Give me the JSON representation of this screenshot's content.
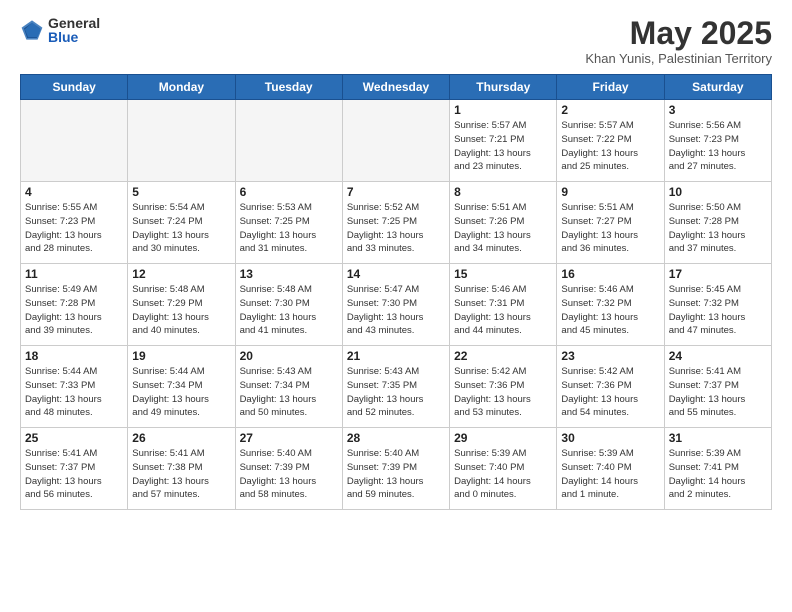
{
  "header": {
    "logo_general": "General",
    "logo_blue": "Blue",
    "month_title": "May 2025",
    "location": "Khan Yunis, Palestinian Territory"
  },
  "weekdays": [
    "Sunday",
    "Monday",
    "Tuesday",
    "Wednesday",
    "Thursday",
    "Friday",
    "Saturday"
  ],
  "weeks": [
    [
      {
        "day": "",
        "info": ""
      },
      {
        "day": "",
        "info": ""
      },
      {
        "day": "",
        "info": ""
      },
      {
        "day": "",
        "info": ""
      },
      {
        "day": "1",
        "info": "Sunrise: 5:57 AM\nSunset: 7:21 PM\nDaylight: 13 hours\nand 23 minutes."
      },
      {
        "day": "2",
        "info": "Sunrise: 5:57 AM\nSunset: 7:22 PM\nDaylight: 13 hours\nand 25 minutes."
      },
      {
        "day": "3",
        "info": "Sunrise: 5:56 AM\nSunset: 7:23 PM\nDaylight: 13 hours\nand 27 minutes."
      }
    ],
    [
      {
        "day": "4",
        "info": "Sunrise: 5:55 AM\nSunset: 7:23 PM\nDaylight: 13 hours\nand 28 minutes."
      },
      {
        "day": "5",
        "info": "Sunrise: 5:54 AM\nSunset: 7:24 PM\nDaylight: 13 hours\nand 30 minutes."
      },
      {
        "day": "6",
        "info": "Sunrise: 5:53 AM\nSunset: 7:25 PM\nDaylight: 13 hours\nand 31 minutes."
      },
      {
        "day": "7",
        "info": "Sunrise: 5:52 AM\nSunset: 7:25 PM\nDaylight: 13 hours\nand 33 minutes."
      },
      {
        "day": "8",
        "info": "Sunrise: 5:51 AM\nSunset: 7:26 PM\nDaylight: 13 hours\nand 34 minutes."
      },
      {
        "day": "9",
        "info": "Sunrise: 5:51 AM\nSunset: 7:27 PM\nDaylight: 13 hours\nand 36 minutes."
      },
      {
        "day": "10",
        "info": "Sunrise: 5:50 AM\nSunset: 7:28 PM\nDaylight: 13 hours\nand 37 minutes."
      }
    ],
    [
      {
        "day": "11",
        "info": "Sunrise: 5:49 AM\nSunset: 7:28 PM\nDaylight: 13 hours\nand 39 minutes."
      },
      {
        "day": "12",
        "info": "Sunrise: 5:48 AM\nSunset: 7:29 PM\nDaylight: 13 hours\nand 40 minutes."
      },
      {
        "day": "13",
        "info": "Sunrise: 5:48 AM\nSunset: 7:30 PM\nDaylight: 13 hours\nand 41 minutes."
      },
      {
        "day": "14",
        "info": "Sunrise: 5:47 AM\nSunset: 7:30 PM\nDaylight: 13 hours\nand 43 minutes."
      },
      {
        "day": "15",
        "info": "Sunrise: 5:46 AM\nSunset: 7:31 PM\nDaylight: 13 hours\nand 44 minutes."
      },
      {
        "day": "16",
        "info": "Sunrise: 5:46 AM\nSunset: 7:32 PM\nDaylight: 13 hours\nand 45 minutes."
      },
      {
        "day": "17",
        "info": "Sunrise: 5:45 AM\nSunset: 7:32 PM\nDaylight: 13 hours\nand 47 minutes."
      }
    ],
    [
      {
        "day": "18",
        "info": "Sunrise: 5:44 AM\nSunset: 7:33 PM\nDaylight: 13 hours\nand 48 minutes."
      },
      {
        "day": "19",
        "info": "Sunrise: 5:44 AM\nSunset: 7:34 PM\nDaylight: 13 hours\nand 49 minutes."
      },
      {
        "day": "20",
        "info": "Sunrise: 5:43 AM\nSunset: 7:34 PM\nDaylight: 13 hours\nand 50 minutes."
      },
      {
        "day": "21",
        "info": "Sunrise: 5:43 AM\nSunset: 7:35 PM\nDaylight: 13 hours\nand 52 minutes."
      },
      {
        "day": "22",
        "info": "Sunrise: 5:42 AM\nSunset: 7:36 PM\nDaylight: 13 hours\nand 53 minutes."
      },
      {
        "day": "23",
        "info": "Sunrise: 5:42 AM\nSunset: 7:36 PM\nDaylight: 13 hours\nand 54 minutes."
      },
      {
        "day": "24",
        "info": "Sunrise: 5:41 AM\nSunset: 7:37 PM\nDaylight: 13 hours\nand 55 minutes."
      }
    ],
    [
      {
        "day": "25",
        "info": "Sunrise: 5:41 AM\nSunset: 7:37 PM\nDaylight: 13 hours\nand 56 minutes."
      },
      {
        "day": "26",
        "info": "Sunrise: 5:41 AM\nSunset: 7:38 PM\nDaylight: 13 hours\nand 57 minutes."
      },
      {
        "day": "27",
        "info": "Sunrise: 5:40 AM\nSunset: 7:39 PM\nDaylight: 13 hours\nand 58 minutes."
      },
      {
        "day": "28",
        "info": "Sunrise: 5:40 AM\nSunset: 7:39 PM\nDaylight: 13 hours\nand 59 minutes."
      },
      {
        "day": "29",
        "info": "Sunrise: 5:39 AM\nSunset: 7:40 PM\nDaylight: 14 hours\nand 0 minutes."
      },
      {
        "day": "30",
        "info": "Sunrise: 5:39 AM\nSunset: 7:40 PM\nDaylight: 14 hours\nand 1 minute."
      },
      {
        "day": "31",
        "info": "Sunrise: 5:39 AM\nSunset: 7:41 PM\nDaylight: 14 hours\nand 2 minutes."
      }
    ]
  ]
}
